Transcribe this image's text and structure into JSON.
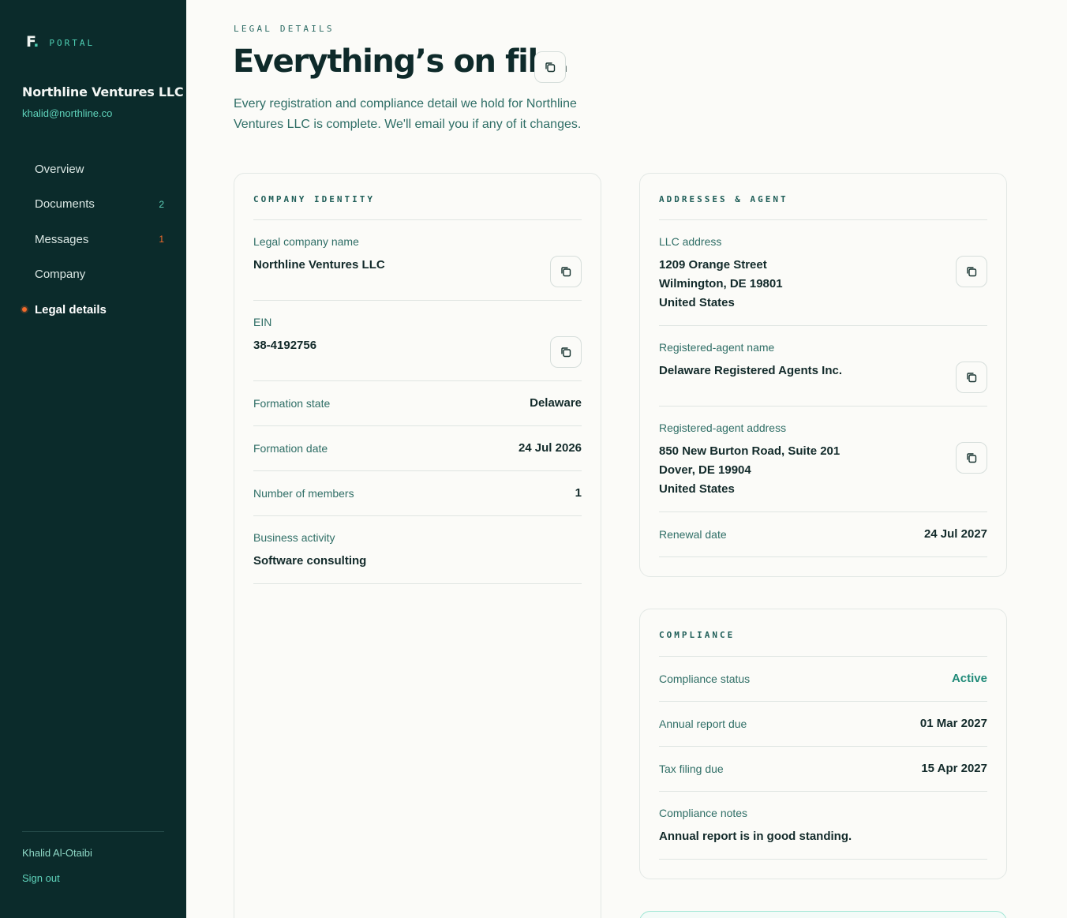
{
  "brand": {
    "logo": "F",
    "label": "PORTAL"
  },
  "org": {
    "name": "Northline Ventures LLC",
    "email": "khalid@northline.co"
  },
  "nav": {
    "items": [
      {
        "label": "Overview",
        "badge": ""
      },
      {
        "label": "Documents",
        "badge": "2"
      },
      {
        "label": "Messages",
        "badge": "1"
      },
      {
        "label": "Company",
        "badge": ""
      },
      {
        "label": "Legal details",
        "badge": ""
      }
    ],
    "active": "Legal details"
  },
  "user": {
    "name": "Khalid Al-Otaibi",
    "signout": "Sign out"
  },
  "header": {
    "eyebrow": "LEGAL DETAILS",
    "title": "Everything’s on file.",
    "intro": "Every registration and compliance detail we hold for Northline Ventures LLC is complete. We'll email you if any of it changes."
  },
  "identity": {
    "title": "COMPANY IDENTITY",
    "legal_name_label": "Legal company name",
    "legal_name": "Northline Ventures LLC",
    "ein_label": "EIN",
    "ein": "38-4192756",
    "formation_state_label": "Formation state",
    "formation_state": "Delaware",
    "formation_date_label": "Formation date",
    "formation_date": "24 Jul 2026",
    "members_label": "Number of members",
    "members": "1",
    "activity_label": "Business activity",
    "activity": "Software consulting"
  },
  "addresses": {
    "title": "ADDRESSES & AGENT",
    "llc_label": "LLC address",
    "llc_line1": "1209 Orange Street",
    "llc_line2": "Wilmington, DE 19801",
    "llc_line3": "United States",
    "agent_name_label": "Registered-agent name",
    "agent_name": "Delaware Registered Agents Inc.",
    "agent_address_label": "Registered-agent address",
    "agent_line1": "850 New Burton Road, Suite 201",
    "agent_line2": "Dover, DE 19904",
    "agent_line3": "United States",
    "renewal_label": "Renewal date",
    "renewal": "24 Jul 2027"
  },
  "compliance": {
    "title": "COMPLIANCE",
    "status_label": "Compliance status",
    "status": "Active",
    "annual_label": "Annual report due",
    "annual": "01 Mar 2027",
    "tax_label": "Tax filing due",
    "tax": "15 Apr 2027",
    "notes_label": "Compliance notes",
    "notes": "Annual report is in good standing."
  },
  "colors": {
    "sidebar": "#0b2b2b",
    "accent": "#4fd1b5",
    "alert": "#f26b2c",
    "status_active": "#1f8a78"
  }
}
